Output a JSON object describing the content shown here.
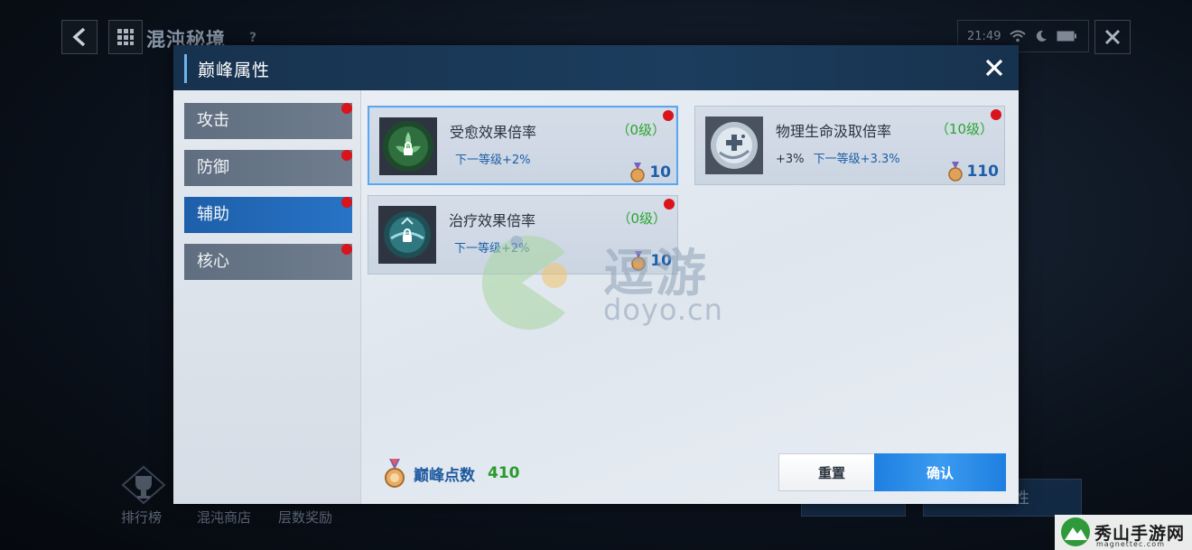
{
  "background": {
    "title": "混沌秘境",
    "help": "?",
    "clock": "21:49",
    "bottom_nav": [
      "排行榜",
      "混沌商店",
      "层数奖励"
    ],
    "ghost_button_2": "性"
  },
  "modal": {
    "title": "巅峰属性",
    "close_label": "✕",
    "tabs": [
      {
        "label": "攻击",
        "active": false,
        "badge": true
      },
      {
        "label": "防御",
        "active": false,
        "badge": true
      },
      {
        "label": "辅助",
        "active": true,
        "badge": true
      },
      {
        "label": "核心",
        "active": false,
        "badge": true
      }
    ],
    "cards": [
      {
        "name": "受愈效果倍率",
        "level": "（0级）",
        "current": "",
        "next": "下一等级+2%",
        "cost": "10",
        "selected": true,
        "icon": "flower-lock-icon"
      },
      {
        "name": "物理生命汲取倍率",
        "level": "（10级）",
        "current": "+3%",
        "next": "下一等级+3.3%",
        "cost": "110",
        "selected": false,
        "icon": "heal-orb-icon"
      },
      {
        "name": "治疗效果倍率",
        "level": "（0级）",
        "current": "",
        "next": "下一等级+2%",
        "cost": "10",
        "selected": false,
        "icon": "water-lock-icon"
      }
    ],
    "points_label": "巅峰点数",
    "points_value": "410",
    "reset_label": "重置",
    "confirm_label": "确认"
  },
  "watermarks": {
    "doyo_cn": "逗游",
    "doyo_en": "doyo.cn",
    "corner_cn": "秀山手游网",
    "corner_en": "magnettec.com"
  },
  "colors": {
    "header": "#17324e",
    "active_tab": "#2873c6",
    "badge": "#d9141b",
    "level_green": "#2aa52e",
    "link_blue": "#1e5fa8",
    "confirm": "#1e7fe0"
  }
}
